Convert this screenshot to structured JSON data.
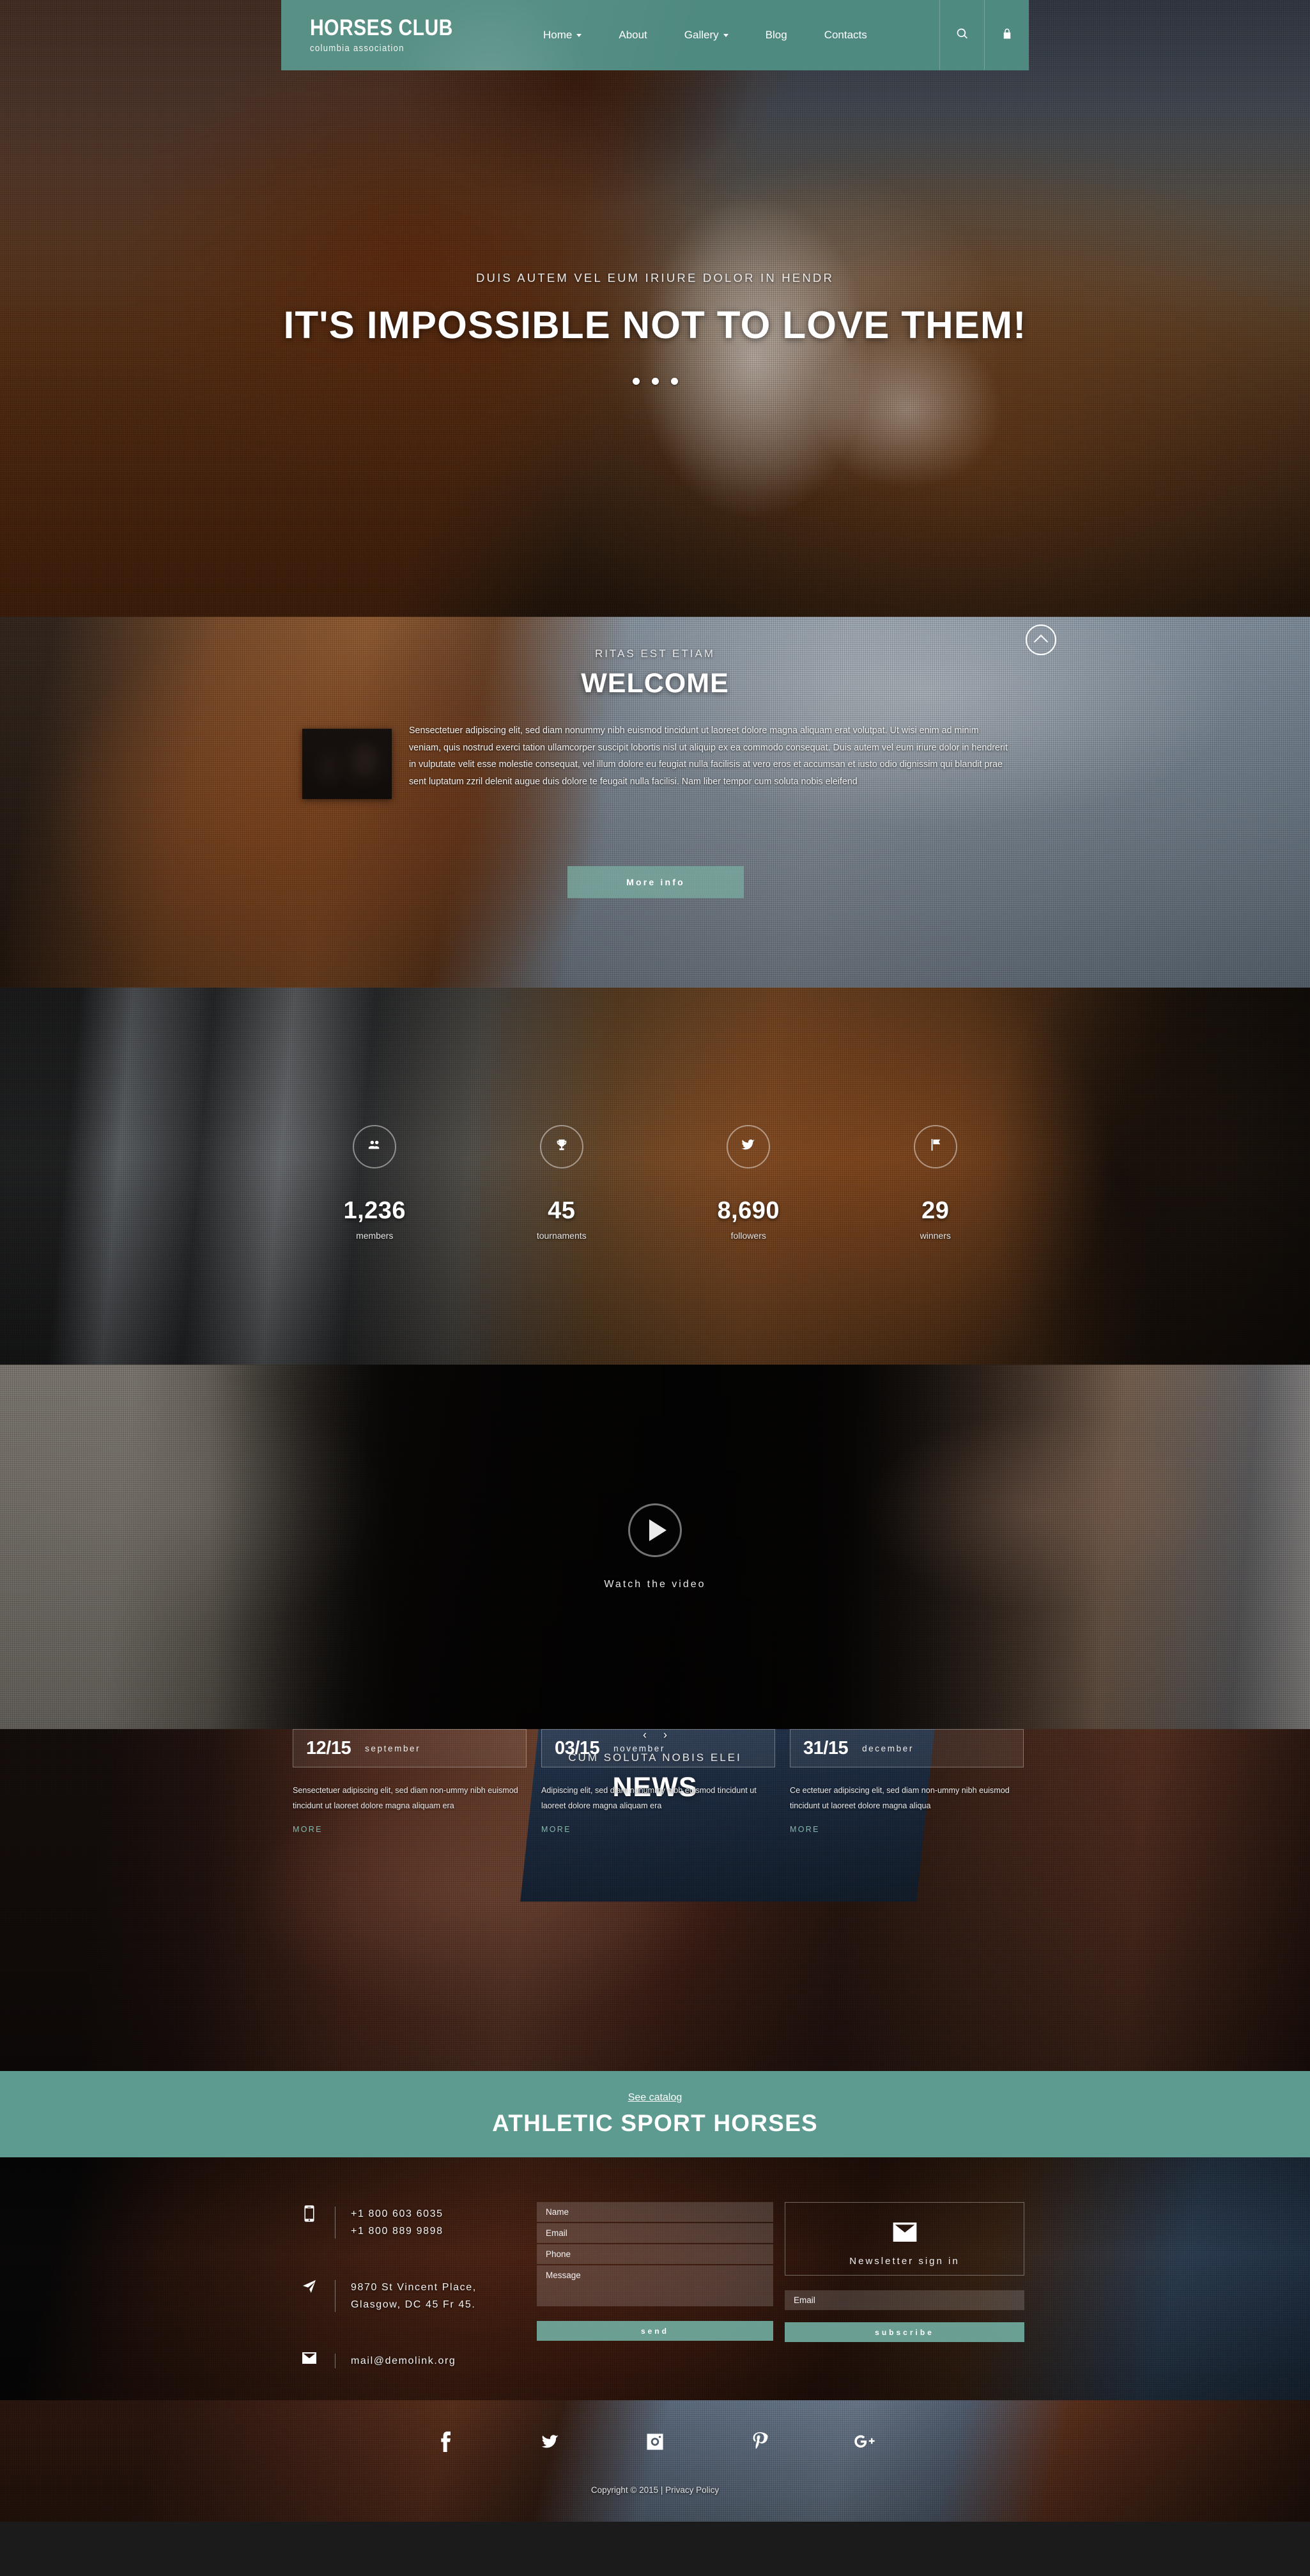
{
  "header": {
    "logo_main": "HORSES CLUB",
    "logo_sub": "columbia association",
    "nav": [
      {
        "label": "Home",
        "has_caret": true
      },
      {
        "label": "About",
        "has_caret": false
      },
      {
        "label": "Gallery",
        "has_caret": true
      },
      {
        "label": "Blog",
        "has_caret": false
      },
      {
        "label": "Contacts",
        "has_caret": false
      }
    ],
    "search_icon": "search-icon",
    "lock_icon": "lock-icon"
  },
  "hero": {
    "subtitle": "DUIS AUTEM VEL EUM IRIURE DOLOR IN HENDR",
    "title": "IT'S IMPOSSIBLE NOT TO LOVE THEM!",
    "dots": 3
  },
  "welcome": {
    "subtitle": "RITAS EST ETIAM",
    "title": "WELCOME",
    "body": "Sensectetuer adipiscing elit, sed diam nonummy nibh euismod tincidunt ut laoreet dolore magna aliquam erat volutpat. Ut wisi enim ad minim veniam, quis nostrud exerci tation ullamcorper suscipit lobortis nisl ut aliquip ex ea commodo consequat. Duis autem vel eum iriure dolor in hendrerit in vulputate velit esse molestie consequat, vel illum dolore eu feugiat nulla facilisis at vero eros et accumsan et iusto odio dignissim qui blandit prae sent luptatum zzril delenit augue duis dolore te feugait nulla facilisi. Nam liber tempor cum soluta nobis eleifend",
    "button_label": "More info",
    "scroll_up_icon": "chevron-up-icon",
    "thumb_alt": "rider-kissing-horse-photo"
  },
  "stats": [
    {
      "icon": "group-icon",
      "value": "1,236",
      "label": "members"
    },
    {
      "icon": "trophy-icon",
      "value": "45",
      "label": "tournaments"
    },
    {
      "icon": "twitter-bird-icon",
      "value": "8,690",
      "label": "followers"
    },
    {
      "icon": "flag-icon",
      "value": "29",
      "label": "winners"
    }
  ],
  "video": {
    "play_icon": "play-icon",
    "label": "Watch the video"
  },
  "news": {
    "subtitle": "CUM SOLUTA NOBIS ELEI",
    "title": "NEWS",
    "cards": [
      {
        "date": "12/15",
        "month": "september",
        "text": "Sensectetuer adipiscing elit, sed diam non-ummy nibh euismod tincidunt ut laoreet dolore magna aliquam era",
        "more": "MORE"
      },
      {
        "date": "03/15",
        "month": "november",
        "text": "Adipiscing elit, sed diam nonummy nibh euismod tincidunt ut laoreet dolore magna aliquam era",
        "more": "MORE"
      },
      {
        "date": "31/15",
        "month": "december",
        "text": "Ce ectetuer adipiscing elit, sed diam non-ummy nibh euismod tincidunt ut laoreet dolore magna aliqua",
        "more": "MORE"
      }
    ],
    "prev_icon": "chevron-left-icon",
    "next_icon": "chevron-right-icon",
    "prev_label": "‹",
    "next_label": "›"
  },
  "catalog": {
    "link_label": "See catalog",
    "title": "ATHLETIC SPORT HORSES",
    "background_color": "#5d9b90"
  },
  "contacts": {
    "phone_icon": "mobile-phone-icon",
    "phones": [
      "+1 800 603 6035",
      "+1 800 889 9898"
    ],
    "address_icon": "location-arrow-icon",
    "address": [
      "9870 St Vincent Place,",
      "Glasgow, DC 45 Fr 45."
    ],
    "mail_icon": "envelope-icon",
    "email": "mail@demolink.org",
    "form": {
      "name_placeholder": "Name",
      "email_placeholder": "Email",
      "phone_placeholder": "Phone",
      "message_placeholder": "Message",
      "send_label": "send"
    },
    "newsletter": {
      "icon": "envelope-icon",
      "title": "Newsletter sign in",
      "email_placeholder": "Email",
      "subscribe_label": "subscribe"
    }
  },
  "footer": {
    "socials": [
      {
        "name": "facebook-icon",
        "glyph": "f"
      },
      {
        "name": "twitter-icon",
        "glyph": "t"
      },
      {
        "name": "instagram-icon",
        "glyph": "i"
      },
      {
        "name": "pinterest-icon",
        "glyph": "p"
      },
      {
        "name": "google-plus-icon",
        "glyph": "g+"
      }
    ],
    "copyright": "Copyright © 2015 |",
    "privacy": "Privacy Policy"
  },
  "theme": {
    "accent": "#5d9b90",
    "accent_light": "#7aaaa0",
    "text_light": "#ffffff"
  }
}
